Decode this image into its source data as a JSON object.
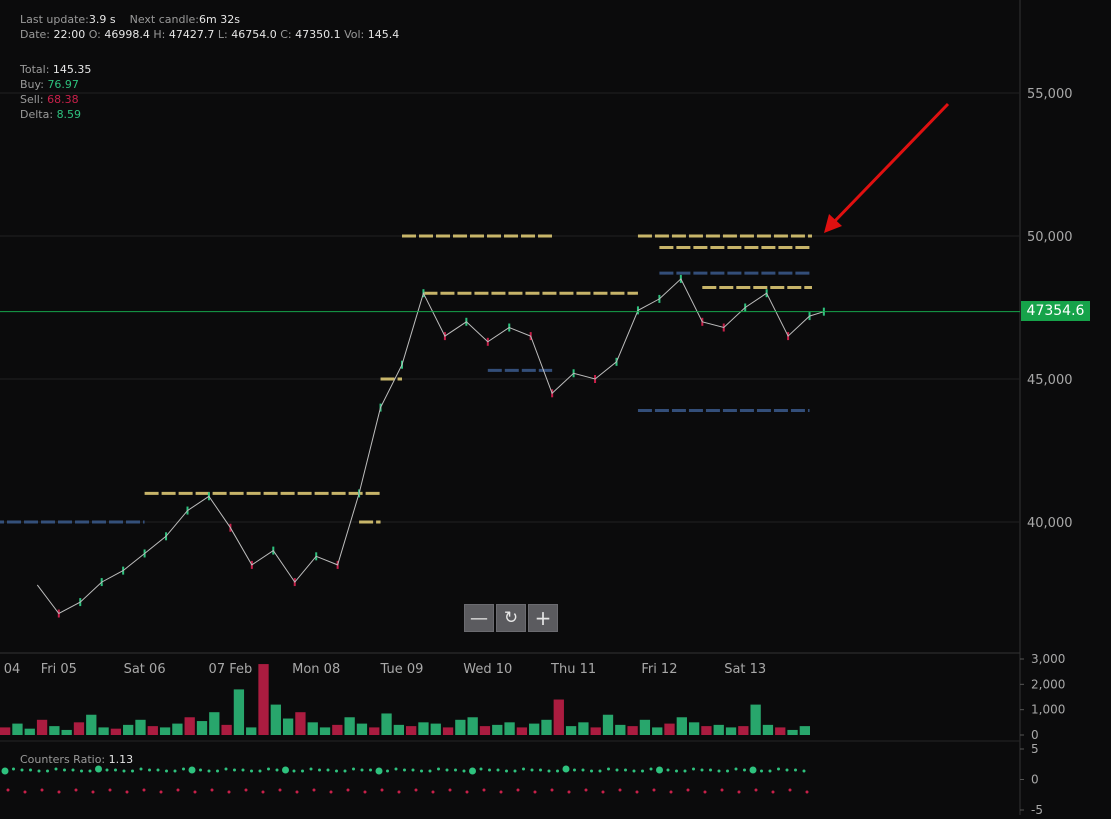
{
  "info": {
    "last_update_label": "Last update:",
    "last_update_value": "3.9 s",
    "next_candle_label": "Next candle:",
    "next_candle_value": "6m 32s",
    "date_label": "Date:",
    "date_value": "22:00",
    "o_label": "O:",
    "o_value": "46998.4",
    "h_label": "H:",
    "h_value": "47427.7",
    "l_label": "L:",
    "l_value": "46754.0",
    "c_label": "C:",
    "c_value": "47350.1",
    "vol_label": "Vol:",
    "vol_value": "145.4"
  },
  "totals": {
    "total_label": "Total:",
    "total_value": "145.35",
    "buy_label": "Buy:",
    "buy_value": "76.97",
    "sell_label": "Sell:",
    "sell_value": "68.38",
    "delta_label": "Delta:",
    "delta_value": "8.59"
  },
  "current_price": "47354.6",
  "counters_ratio_label": "Counters Ratio:",
  "counters_ratio_value": "1.13",
  "controls": {
    "zoom_out_icon": "minus-icon",
    "reset_icon": "refresh-icon",
    "zoom_in_icon": "plus-icon"
  },
  "colors": {
    "up": "#2ec27e",
    "down": "#c8204a",
    "price_line": "#16a34a",
    "order_level_yellow": "#e8d27a",
    "order_level_blue": "#3a5a8c",
    "arrow": "#e01010"
  },
  "chart_data": [
    {
      "type": "line",
      "name": "price",
      "x_ticks": [
        "04",
        "Fri 05",
        "Sat 06",
        "07 Feb",
        "Mon 08",
        "Tue 09",
        "Wed 10",
        "Thu 11",
        "Fri 12",
        "Sat 13"
      ],
      "y_ticks": [
        "55,000",
        "50,000",
        "45,000",
        "40,000"
      ],
      "ylim": [
        36500,
        57000
      ],
      "x": [
        "04 18:00",
        "05 00:00",
        "05 06:00",
        "05 12:00",
        "05 18:00",
        "06 00:00",
        "06 06:00",
        "06 12:00",
        "06 18:00",
        "07 00:00",
        "07 06:00",
        "07 12:00",
        "07 18:00",
        "08 00:00",
        "08 06:00",
        "08 12:00",
        "08 18:00",
        "09 00:00",
        "09 06:00",
        "09 12:00",
        "09 18:00",
        "10 00:00",
        "10 06:00",
        "10 12:00",
        "10 18:00",
        "11 00:00",
        "11 06:00",
        "11 12:00",
        "11 18:00",
        "12 00:00",
        "12 06:00",
        "12 12:00",
        "12 18:00",
        "13 00:00",
        "13 06:00",
        "13 12:00",
        "13 18:00",
        "13 22:00"
      ],
      "y": [
        37800,
        36800,
        37200,
        37900,
        38300,
        38900,
        39500,
        40400,
        40900,
        39800,
        38500,
        39000,
        37900,
        38800,
        38500,
        41000,
        44000,
        45500,
        48000,
        46500,
        47000,
        46300,
        46800,
        46500,
        44500,
        45200,
        45000,
        45600,
        47400,
        47800,
        48500,
        47000,
        46800,
        47500,
        48000,
        46500,
        47200,
        47354.6
      ],
      "order_levels": [
        {
          "price": 50000,
          "color": "yellow",
          "from": "09 00:00",
          "to": "10 18:00"
        },
        {
          "price": 48000,
          "color": "yellow",
          "from": "09 06:00",
          "to": "11 18:00"
        },
        {
          "price": 45000,
          "color": "yellow",
          "from": "08 18:00",
          "to": "09 00:00"
        },
        {
          "price": 41000,
          "color": "yellow",
          "from": "06 00:00",
          "to": "08 18:00"
        },
        {
          "price": 40000,
          "color": "yellow",
          "from": "08 12:00",
          "to": "08 18:00"
        },
        {
          "price": 50000,
          "color": "yellow",
          "from": "11 18:00",
          "to": "13 22:00"
        },
        {
          "price": 49600,
          "color": "yellow",
          "from": "12 00:00",
          "to": "13 22:00"
        },
        {
          "price": 48200,
          "color": "yellow",
          "from": "12 12:00",
          "to": "13 22:00"
        },
        {
          "price": 48700,
          "color": "blue",
          "from": "12 00:00",
          "to": "13 22:00"
        },
        {
          "price": 40000,
          "color": "blue",
          "from": "04 00:00",
          "to": "06 00:00"
        },
        {
          "price": 43900,
          "color": "blue",
          "from": "11 18:00",
          "to": "13 18:00"
        },
        {
          "price": 45300,
          "color": "blue",
          "from": "10 00:00",
          "to": "10 18:00"
        }
      ]
    },
    {
      "type": "bar",
      "name": "volume",
      "y_ticks": [
        "3,000",
        "2,000",
        "1,000",
        "0"
      ],
      "ylim": [
        0,
        3000
      ],
      "values": [
        300,
        450,
        250,
        600,
        350,
        200,
        500,
        800,
        300,
        250,
        400,
        600,
        350,
        300,
        450,
        700,
        550,
        900,
        400,
        1800,
        300,
        2800,
        1200,
        650,
        900,
        500,
        300,
        400,
        700,
        450,
        300,
        850,
        400,
        350,
        500,
        450,
        300,
        600,
        700,
        350,
        400,
        500,
        300,
        450,
        600,
        1400,
        350,
        500,
        300,
        800,
        400,
        350,
        600,
        300,
        450,
        700,
        500,
        350,
        400,
        300,
        350,
        1200,
        400,
        300,
        200,
        350
      ]
    },
    {
      "type": "scatter",
      "name": "counters_ratio",
      "y_ticks": [
        "5",
        "0",
        "-5"
      ],
      "ylim": [
        -5,
        5
      ]
    }
  ]
}
